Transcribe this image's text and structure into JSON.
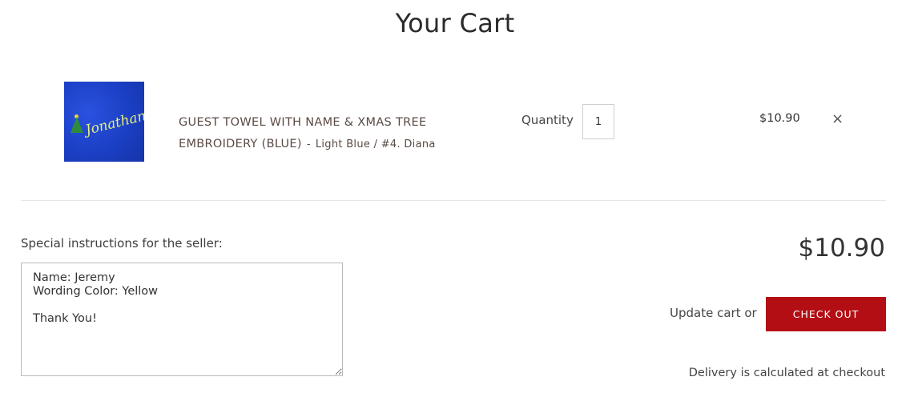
{
  "page": {
    "title": "Your Cart"
  },
  "item": {
    "image_text": "Jonathan",
    "title_line1": "GUEST TOWEL WITH NAME & XMAS TREE",
    "title_line2": "EMBROIDERY (BLUE)",
    "separator": "-",
    "variant": "Light Blue / #4. Diana",
    "quantity_label": "Quantity",
    "quantity_value": "1",
    "price": "$10.90",
    "remove_symbol": "×"
  },
  "notes": {
    "label": "Special instructions for the seller:",
    "value": "Name: Jeremy\nWording Color: Yellow\n\nThank You!"
  },
  "summary": {
    "subtotal": "$10.90",
    "update_label": "Update cart",
    "or_text": "or",
    "checkout_label": "CHECK OUT",
    "delivery_note": "Delivery is calculated at checkout"
  },
  "colors": {
    "checkout_bg": "#b40e15",
    "thumb_bg": "#1b3fc4"
  }
}
